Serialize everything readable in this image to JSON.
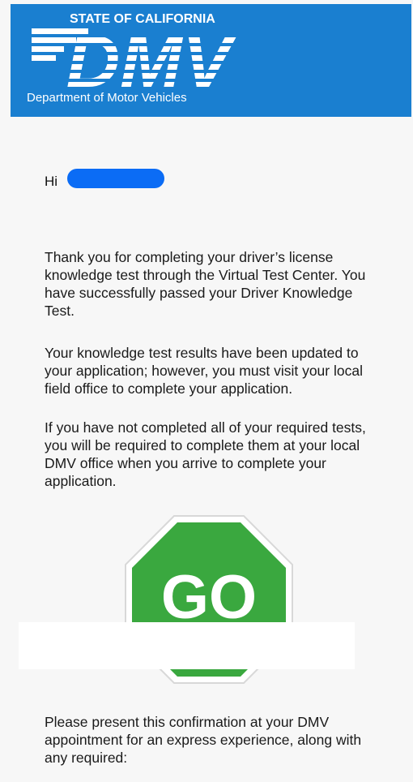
{
  "header": {
    "state_title": "STATE OF CALIFORNIA",
    "logo_text": "DMV",
    "department": "Department of Motor Vehicles",
    "background_color": "#1a7fd0"
  },
  "email": {
    "greeting": "Hi",
    "paragraphs": [
      "Thank you for completing your driver’s license knowledge test through the Virtual Test Center.  You have successfully passed your Driver Knowledge Test.",
      "Your knowledge test results have been updated to your application; however, you must visit your local field office to complete your application.",
      "If you have not completed all of your required tests, you will be required to complete them at your local DMV office when you arrive to complete your application.",
      "Please present this confirmation at your DMV appointment for an express experience, along with any required:"
    ],
    "sign_text": "GO",
    "sign_color": "#3aa83f"
  }
}
